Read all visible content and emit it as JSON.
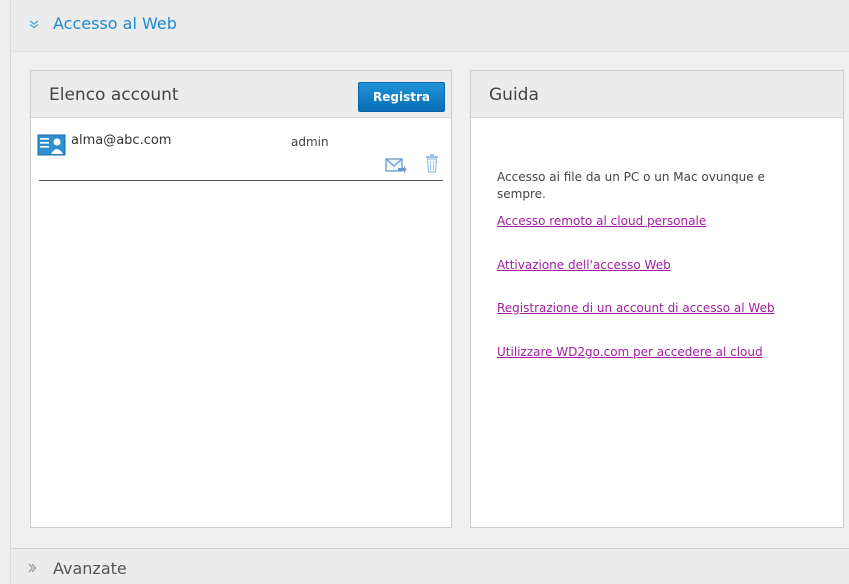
{
  "web_access_section": {
    "title": "Accesso al Web",
    "chevron_icon": "chevron-down-icon"
  },
  "accounts_panel": {
    "title": "Elenco account",
    "register_button": "Registra",
    "accounts": [
      {
        "email": "alma@abc.com",
        "role": "admin"
      }
    ]
  },
  "guide_panel": {
    "title": "Guida",
    "description": "Accesso ai file da un PC o un Mac ovunque e sempre.",
    "links": [
      "Accesso remoto al cloud personale",
      "Attivazione dell'accesso Web",
      "Registrazione di un account di accesso al Web",
      "Utilizzare WD2go.com per accedere al cloud"
    ]
  },
  "advanced_section": {
    "title": "Avanzate",
    "chevron_icon": "chevron-right-icon"
  },
  "colors": {
    "accent": "#1c8ad0",
    "button_blue": "#0a6fb6",
    "link": "#a020a0",
    "panel_header": "#ececec"
  }
}
